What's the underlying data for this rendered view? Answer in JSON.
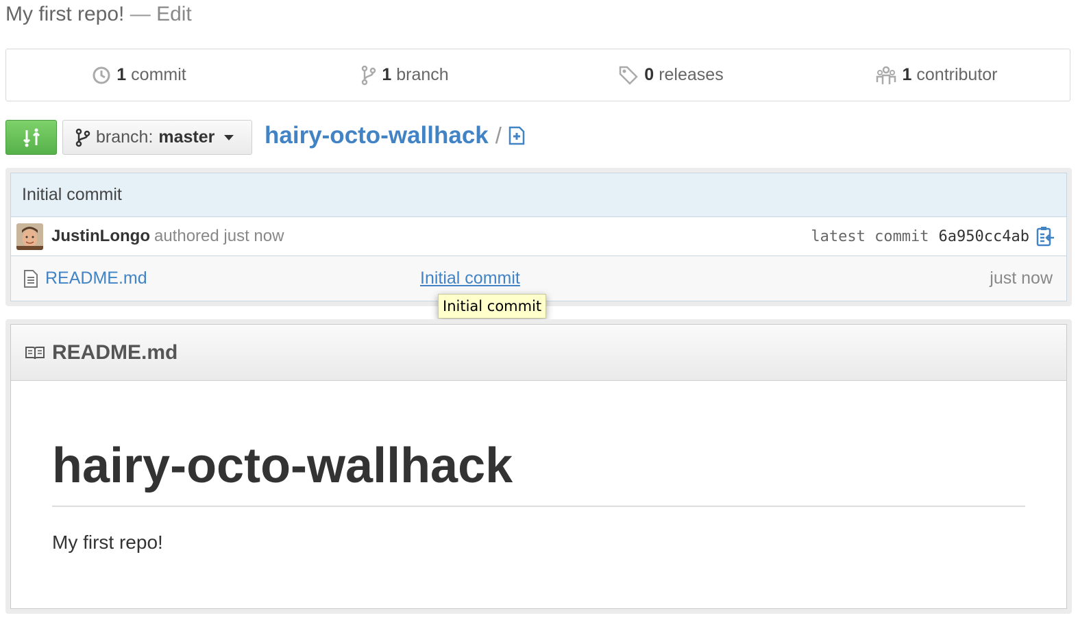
{
  "repo": {
    "description": "My first repo!",
    "separator": "—",
    "edit_label": "Edit",
    "name": "hairy-octo-wallhack"
  },
  "stats": [
    {
      "count": "1",
      "label": "commit",
      "icon": "history-icon"
    },
    {
      "count": "1",
      "label": "branch",
      "icon": "branch-icon"
    },
    {
      "count": "0",
      "label": "releases",
      "icon": "tag-icon"
    },
    {
      "count": "1",
      "label": "contributor",
      "icon": "organization-icon"
    }
  ],
  "branch_selector": {
    "prefix": "branch:",
    "name": "master"
  },
  "breadcrumb": {
    "slash": "/"
  },
  "commit": {
    "message": "Initial commit",
    "author": "JustinLongo",
    "authored_text": "authored just now",
    "latest_label": "latest commit",
    "sha": "6a950cc4ab"
  },
  "files": [
    {
      "name": "README.md",
      "message": "Initial commit",
      "age": "just now"
    }
  ],
  "tooltip": "Initial commit",
  "readme": {
    "header": "README.md",
    "heading": "hairy-octo-wallhack",
    "body": "My first repo!"
  },
  "colors": {
    "link": "#4183c4",
    "green_button": "#6cc644",
    "commit_bar": "#e6f0f7"
  }
}
